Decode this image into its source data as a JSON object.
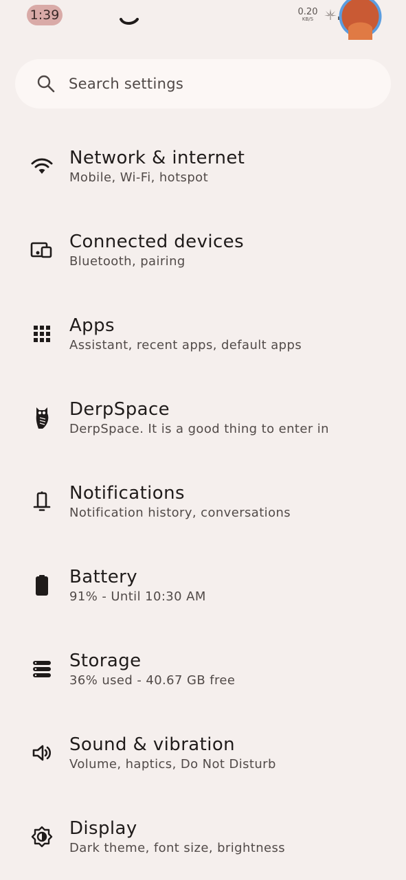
{
  "status_bar": {
    "time": "1:39",
    "net_speed_value": "0.20",
    "net_speed_unit": "KB/S",
    "icons": [
      "weed-icon",
      "signal-icon",
      "signal-hd-icon",
      "battery-icon"
    ]
  },
  "search": {
    "placeholder": "Search settings",
    "icon": "search-icon"
  },
  "settings": {
    "items": [
      {
        "title": "Network & internet",
        "subtitle": "Mobile, Wi‑Fi, hotspot",
        "icon": "wifi-icon"
      },
      {
        "title": "Connected devices",
        "subtitle": "Bluetooth, pairing",
        "icon": "devices-icon"
      },
      {
        "title": "Apps",
        "subtitle": "Assistant, recent apps, default apps",
        "icon": "apps-grid-icon"
      },
      {
        "title": "DerpSpace",
        "subtitle": "DerpSpace. It is a good thing to enter in",
        "icon": "owl-icon"
      },
      {
        "title": "Notifications",
        "subtitle": "Notification history, conversations",
        "icon": "notification-icon"
      },
      {
        "title": "Battery",
        "subtitle": "91% - Until 10:30 AM",
        "icon": "battery-icon"
      },
      {
        "title": "Storage",
        "subtitle": "36% used - 40.67 GB free",
        "icon": "storage-icon"
      },
      {
        "title": "Sound & vibration",
        "subtitle": "Volume, haptics, Do Not Disturb",
        "icon": "speaker-icon"
      },
      {
        "title": "Display",
        "subtitle": "Dark theme, font size, brightness",
        "icon": "display-brightness-icon"
      }
    ]
  },
  "colors": {
    "background": "#f5efed",
    "search_background": "#fcf7f5",
    "time_pill": "#d9aaa7",
    "primary_text": "#1f1b1a",
    "secondary_text": "#514a48"
  }
}
